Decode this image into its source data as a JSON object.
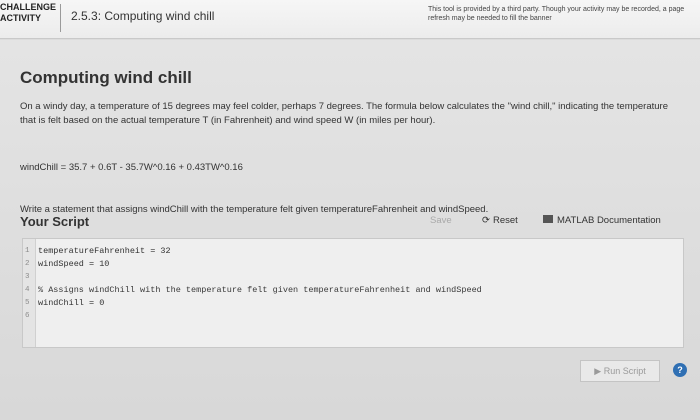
{
  "banner": {
    "badge_line1": "CHALLENGE",
    "badge_line2": "ACTIVITY",
    "section_title": "2.5.3: Computing wind chill",
    "notice": "This tool is provided by a third party. Though your activity may be recorded, a page refresh may be needed to fill the banner"
  },
  "main": {
    "heading": "Computing wind chill",
    "description": "On a windy day, a temperature of 15 degrees may feel colder, perhaps 7 degrees. The formula below calculates the \"wind chill,\" indicating the temperature that is felt based on the actual temperature T (in Fahrenheit) and wind speed W (in miles per hour).",
    "formula": "windChill = 35.7 + 0.6T - 35.7W^0.16 + 0.43TW^0.16",
    "instruction": "Write a statement that assigns windChill with the temperature felt given temperatureFahrenheit and windSpeed."
  },
  "script": {
    "label": "Your Script",
    "save_label": "Save",
    "reset_label": "Reset",
    "docs_label": "MATLAB Documentation",
    "run_label": "Run Script",
    "help_label": "?",
    "lines": [
      {
        "n": "1",
        "text": "temperatureFahrenheit = 32"
      },
      {
        "n": "2",
        "text": "windSpeed = 10"
      },
      {
        "n": "3",
        "text": ""
      },
      {
        "n": "4",
        "text": "% Assigns windChill with the temperature felt given temperatureFahrenheit and windSpeed"
      },
      {
        "n": "5",
        "text": "windChill = 0"
      },
      {
        "n": "6",
        "text": ""
      }
    ]
  },
  "colors": {
    "accent": "#2f6fb3",
    "disabled_text": "#a9a9a9"
  }
}
